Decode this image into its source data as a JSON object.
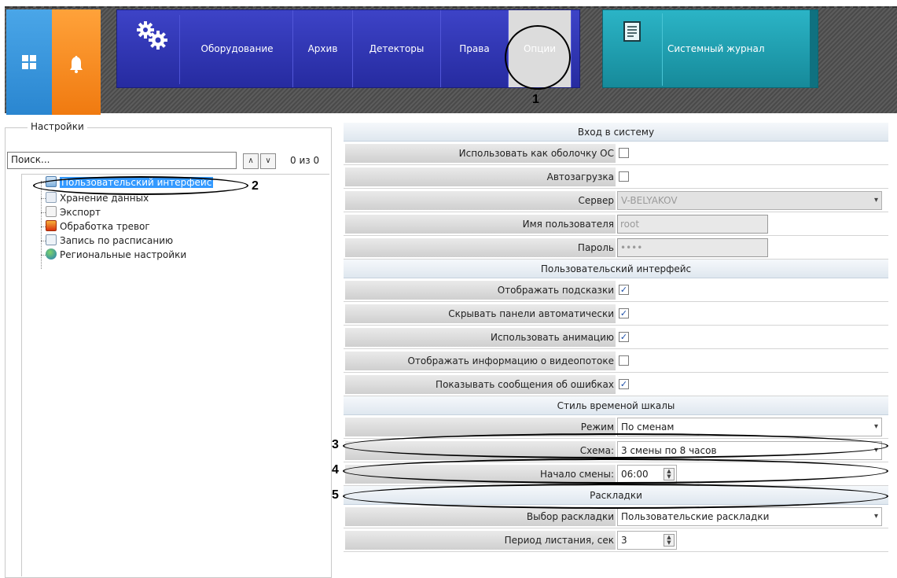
{
  "nav": {
    "items": [
      {
        "label": "Оборудование"
      },
      {
        "label": "Архив"
      },
      {
        "label": "Детекторы"
      },
      {
        "label": "Права"
      },
      {
        "label": "Опции"
      }
    ],
    "journal_label": "Системный журнал"
  },
  "callouts": [
    "1",
    "2",
    "3",
    "4",
    "5"
  ],
  "settings_panel": {
    "title": "Настройки",
    "search_value": "Поиск...",
    "up_arrow": "∧",
    "down_arrow": "∨",
    "search_count": "0 из 0",
    "tree": [
      {
        "label": "Пользовательский интерфейс",
        "icon": "monitor-icon",
        "selected": true
      },
      {
        "label": "Хранение данных",
        "icon": "storage-icon"
      },
      {
        "label": "Экспорт",
        "icon": "export-icon"
      },
      {
        "label": "Обработка тревог",
        "icon": "alarm-icon"
      },
      {
        "label": "Запись по расписанию",
        "icon": "schedule-icon"
      },
      {
        "label": "Региональные настройки",
        "icon": "globe-icon"
      }
    ]
  },
  "properties": {
    "login": {
      "header": "Вход в систему",
      "shell_label": "Использовать как оболочку ОС",
      "shell_checked": false,
      "autoload_label": "Автозагрузка",
      "autoload_checked": false,
      "server_label": "Сервер",
      "server_value": "V-BELYAKOV",
      "username_label": "Имя пользователя",
      "username_value": "root",
      "password_label": "Пароль",
      "password_value": "••••"
    },
    "ui": {
      "header": "Пользовательский интерфейс",
      "hints_label": "Отображать подсказки",
      "hints_checked": true,
      "hide_panels_label": "Скрывать панели автоматически",
      "hide_panels_checked": true,
      "animation_label": "Использовать анимацию",
      "animation_checked": true,
      "stream_info_label": "Отображать информацию о видеопотоке",
      "stream_info_checked": false,
      "errors_label": "Показывать сообщения об ошибках",
      "errors_checked": true
    },
    "timeline": {
      "header": "Стиль временой шкалы",
      "mode_label": "Режим",
      "mode_value": "По сменам",
      "scheme_label": "Схема:",
      "scheme_value": "3 смены по 8 часов",
      "shift_start_label": "Начало смены:",
      "shift_start_value": "06:00"
    },
    "layouts": {
      "header": "Раскладки",
      "select_label": "Выбор раскладки",
      "select_value": "Пользовательские раскладки",
      "period_label": "Период листания, сек",
      "period_value": "3"
    }
  },
  "check_mark": "✓",
  "dropdown_arrow": "▾",
  "spin_up": "▲",
  "spin_down": "▼"
}
